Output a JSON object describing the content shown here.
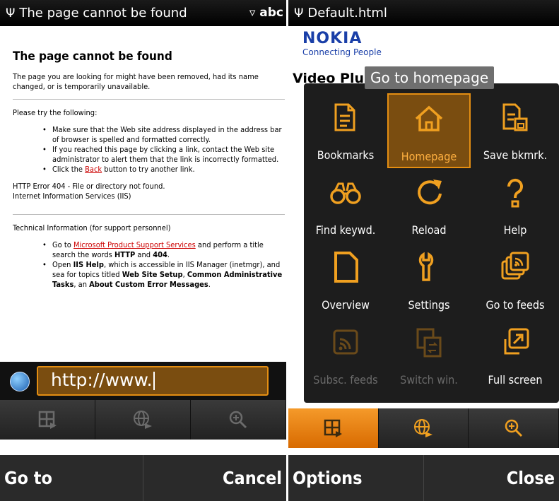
{
  "left": {
    "status_title": "The page cannot be found",
    "status_right": "abc",
    "status_signal": "Ψ",
    "input_indicator": "▿",
    "heading": "The page cannot be found",
    "intro": "The page you are looking for might have been removed, had its name changed, or is temporarily unavailable.",
    "try_label": "Please try the following:",
    "bullet1": "Make sure that the Web site address displayed in the address bar of browser is spelled and formatted correctly.",
    "bullet2": "If you reached this page by clicking a link, contact the Web site administrator to alert them that the link is incorrectly formatted.",
    "bullet3_pre": "Click the ",
    "bullet3_link": "Back",
    "bullet3_post": " button to try another link.",
    "http_error": "HTTP Error 404 - File or directory not found.",
    "iis": "Internet Information Services (IIS)",
    "tech_label": "Technical Information (for support personnel)",
    "tb1_pre": "Go to ",
    "tb1_link": "Microsoft Product Support Services",
    "tb1_post": " and perform a title search the words ",
    "tb1_http": "HTTP",
    "tb1_and": " and ",
    "tb1_404": "404",
    "tb1_end": ".",
    "tb2_pre": "Open ",
    "tb2_iis": "IIS Help",
    "tb2_mid": ", which is accessible in IIS Manager (inetmgr), and sea for topics titled ",
    "tb2_wss": "Web Site Setup",
    "tb2_sep": ", ",
    "tb2_cat": "Common Administrative Tasks",
    "tb2_an": ", an ",
    "tb2_acem": "About Custom Error Messages",
    "tb2_end": ".",
    "url_value": "http://www.",
    "softkey_left": "Go to",
    "softkey_right": "Cancel"
  },
  "right": {
    "status_title": "Default.html",
    "status_signal": "Ψ",
    "nokia_brand": "NOKIA",
    "nokia_tag": "Connecting People",
    "page_heading": "Video Plu",
    "tooltip": "Go to homepage",
    "menu": [
      {
        "label": "Bookmarks",
        "icon": "bookmarks-icon"
      },
      {
        "label": "Homepage",
        "icon": "home-icon",
        "selected": true
      },
      {
        "label": "Save bkmrk.",
        "icon": "save-bookmark-icon"
      },
      {
        "label": "Find keywd.",
        "icon": "binoculars-icon"
      },
      {
        "label": "Reload",
        "icon": "reload-icon"
      },
      {
        "label": "Help",
        "icon": "help-icon"
      },
      {
        "label": "Overview",
        "icon": "overview-icon"
      },
      {
        "label": "Settings",
        "icon": "settings-icon"
      },
      {
        "label": "Go to feeds",
        "icon": "feeds-icon"
      },
      {
        "label": "Subsc. feeds",
        "icon": "subscribe-feeds-icon",
        "disabled": true
      },
      {
        "label": "Switch win.",
        "icon": "switch-window-icon",
        "disabled": true
      },
      {
        "label": "Full screen",
        "icon": "fullscreen-icon"
      }
    ],
    "softkey_left": "Options",
    "softkey_right": "Close"
  },
  "colors": {
    "accent": "#e48e12",
    "accent_fill": "#7a4d10",
    "link": "#c00000",
    "nokia_blue": "#1a3fa8"
  }
}
